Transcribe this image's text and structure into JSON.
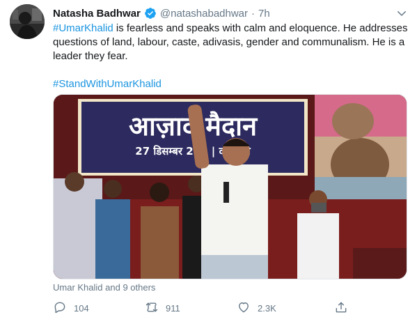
{
  "tweet": {
    "author_name": "Natasha Badhwar",
    "handle": "@natashabadhwar",
    "separator": "·",
    "time": "7h",
    "text_hashtag": "#UmarKhalid",
    "text_body": " is fearless and speaks with calm and eloquence. He addresses questions of land, labour, caste, adivasis, gender and communalism. He is a leader they fear.",
    "hashtag2": "#StandWithUmarKhalid"
  },
  "media": {
    "banner_line1": "आज़ाद मैदान",
    "banner_line2": "27 डिसम्बर 201  |  दोप    बजे"
  },
  "tagged": "Umar Khalid and 9 others",
  "actions": {
    "reply_count": "104",
    "retweet_count": "911",
    "like_count": "2.3K"
  },
  "colors": {
    "link": "#1b95e0",
    "muted": "#657786",
    "verified": "#1da1f2"
  }
}
